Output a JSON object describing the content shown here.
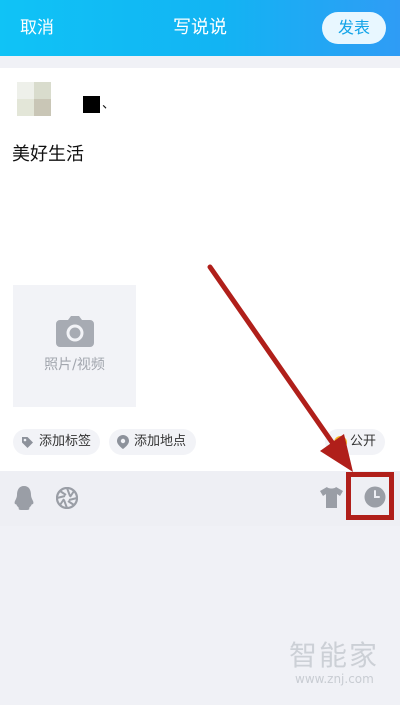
{
  "header": {
    "cancel_label": "取消",
    "title": "写说说",
    "publish_label": "发表"
  },
  "user": {
    "name_suffix": "、"
  },
  "post": {
    "text": "美好生活"
  },
  "media": {
    "add_label": "照片/视频"
  },
  "options": {
    "tag_label": "添加标签",
    "location_label": "添加地点",
    "visibility_label": "公开"
  },
  "toolbar": {
    "items": [
      "qq-icon",
      "aperture-icon",
      "tshirt-icon",
      "clock-icon"
    ]
  },
  "annotation": {
    "color": "#b01f1a"
  },
  "watermark": {
    "brand": "智能家",
    "domain": "www.znj.com"
  }
}
